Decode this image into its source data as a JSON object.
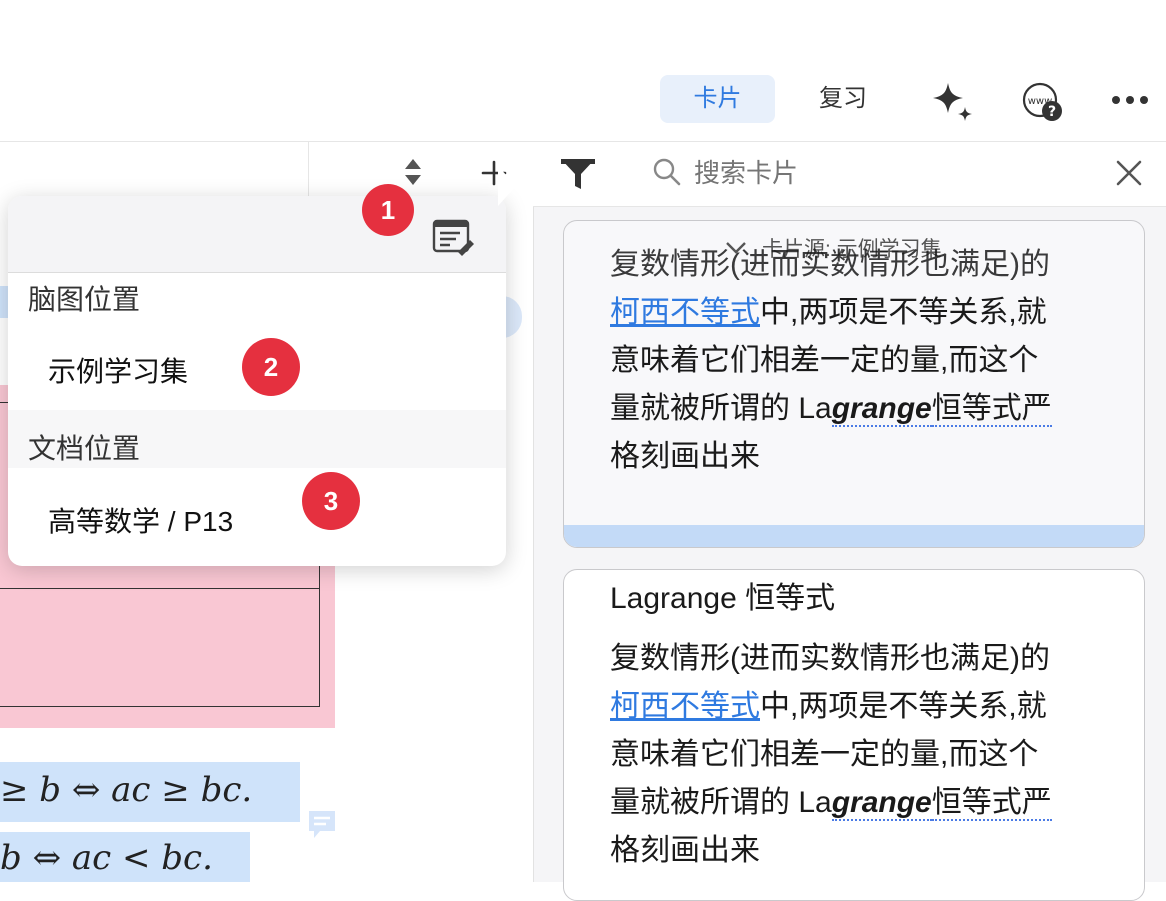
{
  "header": {
    "tabs": [
      {
        "label": "卡片",
        "active": true
      },
      {
        "label": "复习",
        "active": false
      }
    ],
    "icons": [
      "sparkle-icon",
      "web-help-icon",
      "more-icon"
    ]
  },
  "search": {
    "placeholder": "搜索卡片",
    "icons": [
      "filter-icon",
      "search-icon",
      "close-icon"
    ]
  },
  "left_toolbar": {
    "icons": [
      "sort-icon",
      "add-icon"
    ]
  },
  "document": {
    "math_line_1": "≥ b ⇔ ac ≥ bc.",
    "math_line_2": "b ⇔ ac < bc.",
    "comment_icon": "comment-icon"
  },
  "popover": {
    "header_icon": "edit-note-icon",
    "mindmap_section": "脑图位置",
    "mindmap_item": "示例学习集",
    "document_section": "文档位置",
    "document_item": "高等数学 / P13",
    "badges": [
      "1",
      "2",
      "3"
    ]
  },
  "cards": {
    "source_label": "卡片源: 示例学习集",
    "card_1": {
      "line_1": "复数情形(进而实数情形也满足)的",
      "link": "柯西不等式",
      "line_2_rest": "中,两项是不等关系,就",
      "line_3": "意味着它们相差一定的量,而这个",
      "line_4_prefix": "量就被所谓的 La",
      "line_4_bold": "grange",
      "line_4_suffix": "恒等式严",
      "line_5": "格刻画出来"
    },
    "card_2": {
      "title": "Lagrange 恒等式",
      "line_1": "复数情形(进而实数情形也满足)的",
      "link": "柯西不等式",
      "line_2_rest": "中,两项是不等关系,就",
      "line_3": "意味着它们相差一定的量,而这个",
      "line_4_prefix": "量就被所谓的 La",
      "line_4_bold": "grange",
      "line_4_suffix": "恒等式严",
      "line_5": "格刻画出来"
    }
  },
  "colors": {
    "accent": "#2f7ae0",
    "badge": "#e5303f",
    "pink_highlight": "#f9c7d3",
    "blue_highlight": "#cfe3fa"
  }
}
